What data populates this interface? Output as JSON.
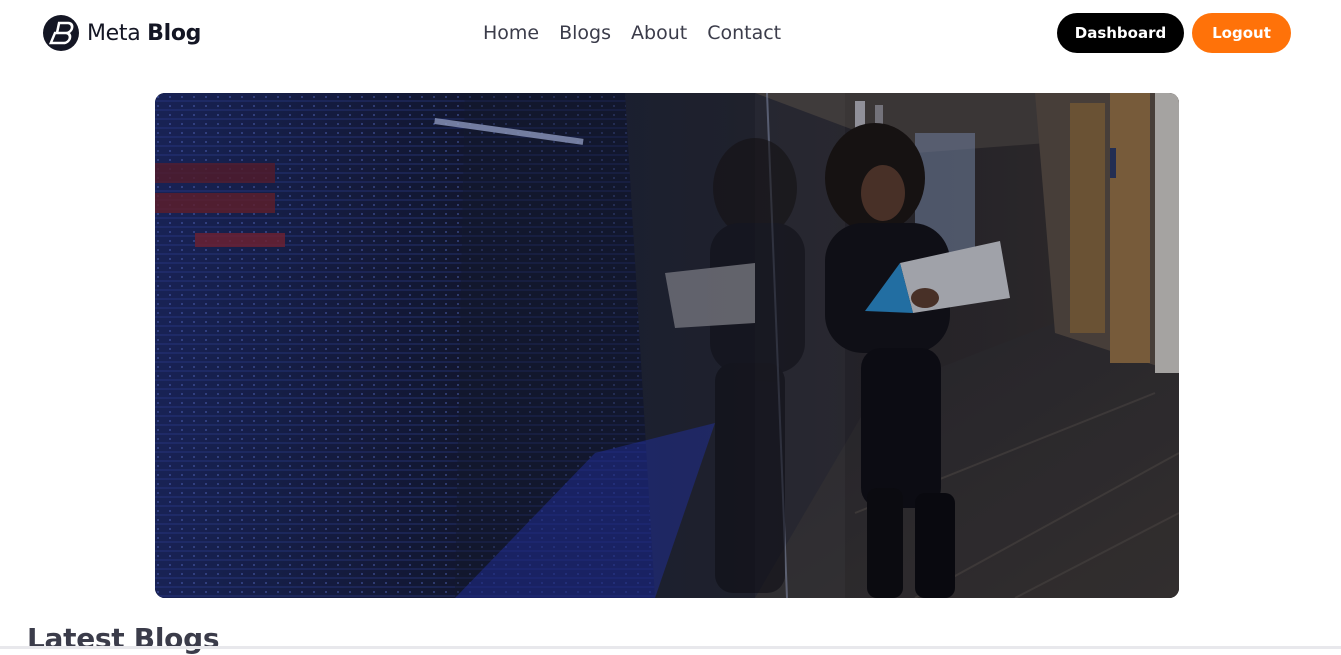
{
  "brand": {
    "name_regular": "Meta",
    "name_bold": "Blog",
    "logo_icon": "meta-blog-logo-icon"
  },
  "nav": {
    "items": [
      {
        "label": "Home"
      },
      {
        "label": "Blogs"
      },
      {
        "label": "About"
      },
      {
        "label": "Contact"
      }
    ]
  },
  "actions": {
    "dashboard_label": "Dashboard",
    "logout_label": "Logout"
  },
  "hero": {
    "image": "hero-image"
  },
  "section": {
    "latest_title": "Latest Blogs"
  },
  "colors": {
    "accent": "#ff7209",
    "dark_button": "#000000",
    "text": "#3b3c4a"
  }
}
